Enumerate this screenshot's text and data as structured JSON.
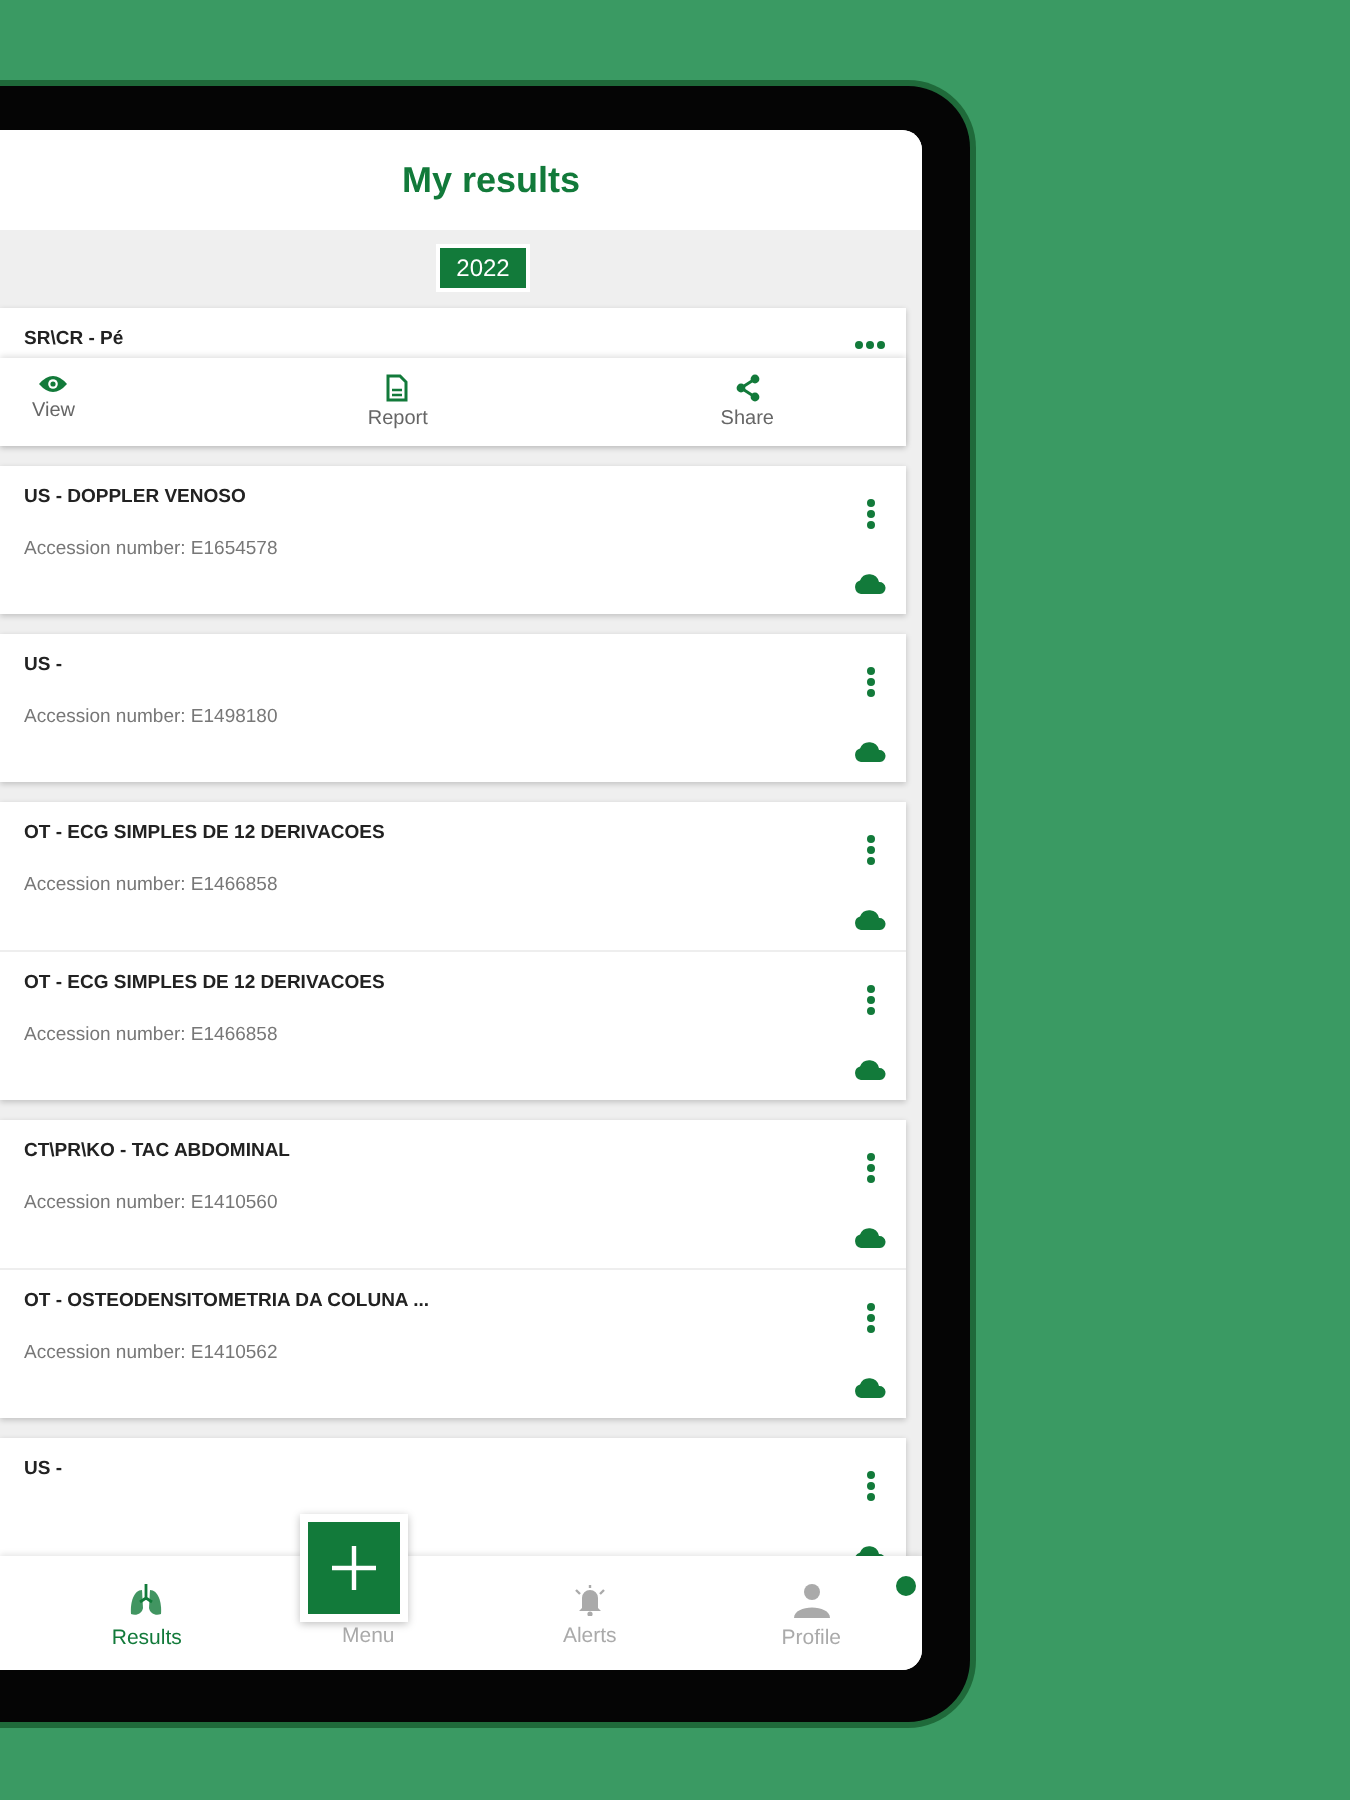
{
  "header": {
    "title": "My results"
  },
  "year": "2022",
  "groups": [
    {
      "items": [
        {
          "title": "SR\\CR - Pé",
          "expanded": true,
          "actions": [
            {
              "kind": "view",
              "label": "View"
            },
            {
              "kind": "report",
              "label": "Report"
            },
            {
              "kind": "share",
              "label": "Share"
            }
          ]
        }
      ]
    },
    {
      "items": [
        {
          "title": "US - DOPPLER VENOSO",
          "accession": "Accession number: E1654578",
          "expanded": false
        }
      ]
    },
    {
      "items": [
        {
          "title": "US -",
          "accession": "Accession number: E1498180",
          "expanded": false
        }
      ]
    },
    {
      "items": [
        {
          "title": "OT - ECG SIMPLES DE 12 DERIVACOES",
          "accession": "Accession number: E1466858",
          "expanded": false
        },
        {
          "title": "OT - ECG SIMPLES DE 12 DERIVACOES",
          "accession": "Accession number: E1466858",
          "expanded": false
        }
      ]
    },
    {
      "items": [
        {
          "title": "CT\\PR\\KO - TAC ABDOMINAL",
          "accession": "Accession number: E1410560",
          "expanded": false
        },
        {
          "title": "OT - OSTEODENSITOMETRIA DA COLUNA ...",
          "accession": "Accession number: E1410562",
          "expanded": false
        }
      ]
    },
    {
      "items": [
        {
          "title": "US -",
          "expanded": false
        }
      ]
    }
  ],
  "nav": [
    {
      "kind": "results",
      "label": "Results",
      "selected": true
    },
    {
      "kind": "menu",
      "label": "Menu",
      "selected": false
    },
    {
      "kind": "alerts",
      "label": "Alerts",
      "selected": false
    },
    {
      "kind": "profile",
      "label": "Profile",
      "selected": false,
      "badge": true
    }
  ]
}
